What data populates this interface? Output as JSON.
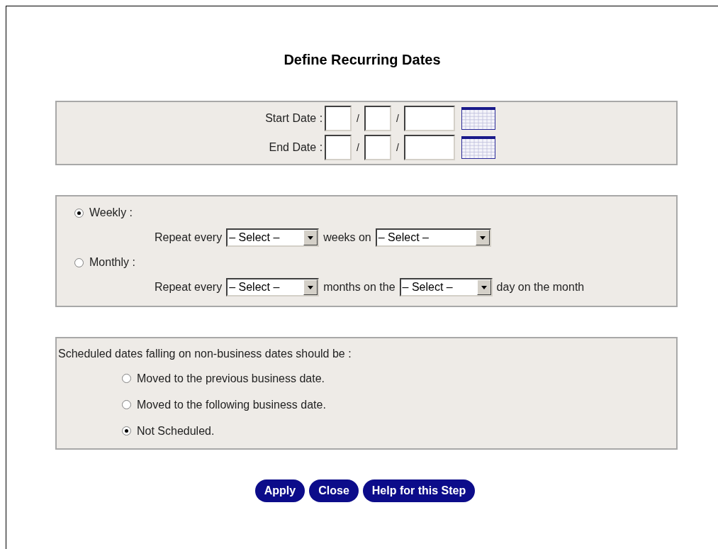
{
  "title": "Define Recurring Dates",
  "date_fields": [
    {
      "label": "Start Date :",
      "separators": [
        "/",
        "/"
      ]
    },
    {
      "label": "End Date :",
      "separators": [
        "/",
        "/"
      ]
    }
  ],
  "recurrence": [
    {
      "label": "Weekly :",
      "selected": true,
      "parts": [
        {
          "kind": "text",
          "text": "Repeat every"
        },
        {
          "kind": "select",
          "value": "– Select –"
        },
        {
          "kind": "text",
          "text": "weeks on"
        },
        {
          "kind": "wide_select",
          "value": "– Select –"
        }
      ]
    },
    {
      "label": "Monthly :",
      "selected": false,
      "parts": [
        {
          "kind": "text",
          "text": "Repeat every"
        },
        {
          "kind": "select",
          "value": "– Select –"
        },
        {
          "kind": "text",
          "text": "months on the"
        },
        {
          "kind": "select",
          "value": "– Select –"
        },
        {
          "kind": "text",
          "text": "day on the month"
        }
      ]
    }
  ],
  "non_business": {
    "heading": "Scheduled dates falling on non-business dates should be :",
    "options": [
      {
        "label": "Moved to the previous business date.",
        "selected": false
      },
      {
        "label": "Moved to the following business date.",
        "selected": false
      },
      {
        "label": "Not Scheduled.",
        "selected": true
      }
    ]
  },
  "buttons": [
    "Apply",
    "Close",
    "Help for this Step"
  ]
}
